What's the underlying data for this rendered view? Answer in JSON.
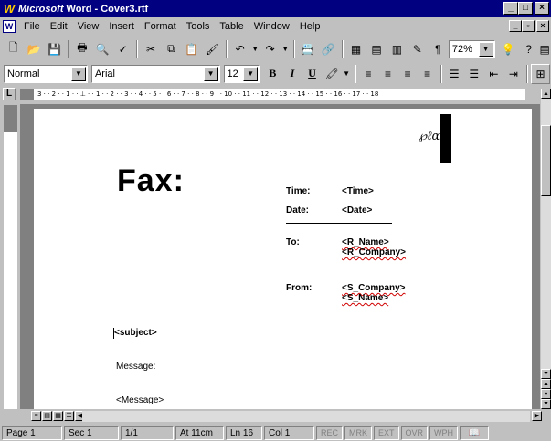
{
  "titlebar": {
    "app_icon": "W",
    "app_name": "Microsoft",
    "title": " Word - Cover3.rtf",
    "min": "_",
    "max": "□",
    "close": "×"
  },
  "menubar": {
    "items": [
      "File",
      "Edit",
      "View",
      "Insert",
      "Format",
      "Tools",
      "Table",
      "Window",
      "Help"
    ],
    "doc_min": "_",
    "doc_restore": "▫",
    "doc_close": "×"
  },
  "toolbar1": {
    "zoom": "72%"
  },
  "toolbar2": {
    "style": "Normal",
    "font": "Arial",
    "size": "12",
    "bold": "B",
    "italic": "I",
    "underline": "U"
  },
  "ruler": {
    "corner": "L",
    "scale": "3 · · 2 · · 1 · · ⊥ · · 1 · · 2 · · 3 · · 4 · · 5 · · 6 · · 7 · · 8 · · 9 · · 10 · · 11 · · 12 · · 13 · · 14 · · 15 · · 16 · · 17 · · 18"
  },
  "document": {
    "fax_title": "Fax:",
    "time_label": "Time:",
    "time_value": "<Time>",
    "date_label": "Date:",
    "date_value": "<Date>",
    "to_label": "To:",
    "to_name": "<R_Name>",
    "to_company": "<R_Company>",
    "from_label": "From:",
    "from_company": "<S_Company>",
    "from_name": "<S_Name>",
    "subject": "<subject>",
    "message_label": "Message:",
    "message_value": "<Message>"
  },
  "statusbar": {
    "page": "Page 1",
    "sec": "Sec 1",
    "pages": "1/1",
    "at": "At 11cm",
    "ln": "Ln 16",
    "col": "Col 1",
    "rec": "REC",
    "mrk": "MRK",
    "ext": "EXT",
    "ovr": "OVR",
    "wph": "WPH"
  }
}
